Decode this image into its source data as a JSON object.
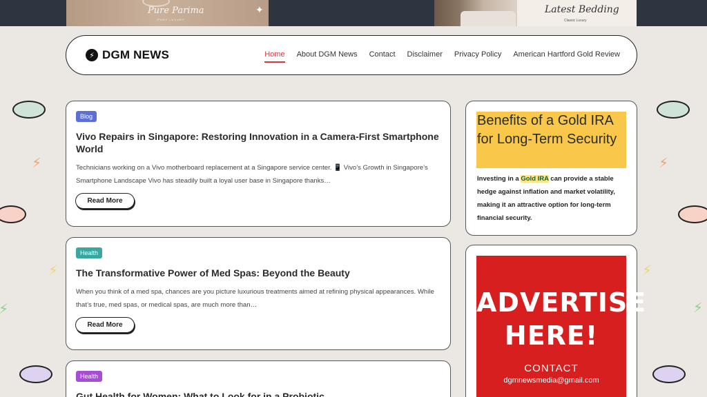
{
  "banners": {
    "left": {
      "brand": "Pure Parima",
      "tagline": "PURE LUXURY"
    },
    "right": {
      "title": "Latest Bedding",
      "tagline": "Classic Luxury"
    }
  },
  "site": {
    "logo_text": "DGM NEWS"
  },
  "nav": [
    {
      "label": "Home",
      "active": true
    },
    {
      "label": "About DGM News"
    },
    {
      "label": "Contact"
    },
    {
      "label": "Disclaimer"
    },
    {
      "label": "Privacy Policy"
    },
    {
      "label": "American Hartford Gold Review"
    }
  ],
  "posts": [
    {
      "badge": "Blog",
      "badge_color": "#5b6fd6",
      "title": "Vivo Repairs in Singapore: Restoring Innovation in a Camera-First Smartphone World",
      "excerpt": "Technicians working on a Vivo motherboard replacement at a Singapore service center. 📱 Vivo’s Growth in Singapore’s Smartphone Landscape Vivo has steadily built a loyal user base in Singapore thanks…",
      "read_more": "Read More"
    },
    {
      "badge": "Health",
      "badge_color": "#3aa6a0",
      "title": "The Transformative Power of Med Spas: Beyond the Beauty",
      "excerpt": "When you think of a med spa, chances are you picture luxurious treatments aimed at refining physical appearances. While that’s true, med spas, or medical spas, are much more than…",
      "read_more": "Read More"
    },
    {
      "badge": "Health",
      "badge_color": "#a64dd6",
      "title": "Gut Health for Women: What to Look for in a Probiotic"
    }
  ],
  "sidebar": {
    "gold": {
      "title": "Benefits of a Gold IRA for Long-Term Security",
      "text_before": "Investing in a ",
      "link": "Gold IRA",
      "text_after": " can provide a stable hedge against inflation and market volatility, making it an attractive option for long-term financial security."
    },
    "ad": {
      "headline_1": "ADVERTISE",
      "headline_2": "HERE!",
      "contact_label": "CONTACT",
      "email": "dgmnewsmedia@gmail.com"
    }
  }
}
